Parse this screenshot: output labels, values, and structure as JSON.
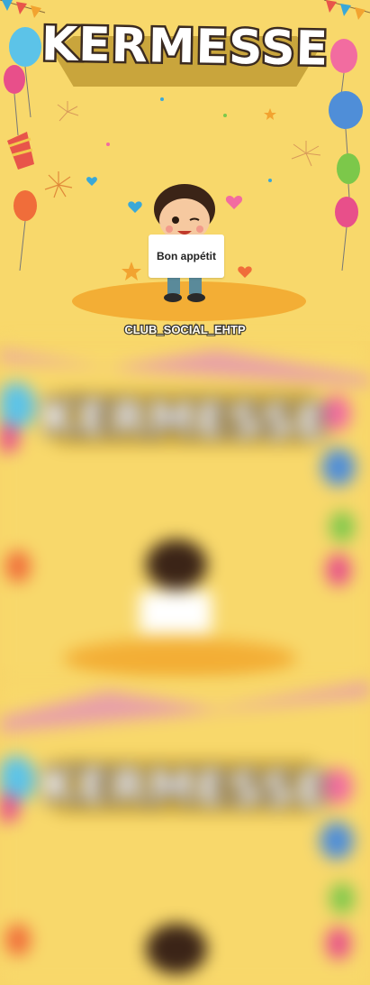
{
  "poster": {
    "title": "KERMESSE",
    "sign_text": "Bon appétit",
    "club_name": "CLUB_SOCIAL_EHTP"
  },
  "colors": {
    "background": "#f8d86b",
    "ribbon": "#c9a53c",
    "stage": "#f3ae35",
    "balloon_blue": "#5cc3e8",
    "balloon_pink": "#e84f8a",
    "balloon_green": "#7cc84a",
    "balloon_orange": "#f06d3a"
  },
  "icons": [
    "balloon-icon",
    "party-popper-icon",
    "heart-icon",
    "firework-icon",
    "star-icon",
    "bunting-icon"
  ]
}
